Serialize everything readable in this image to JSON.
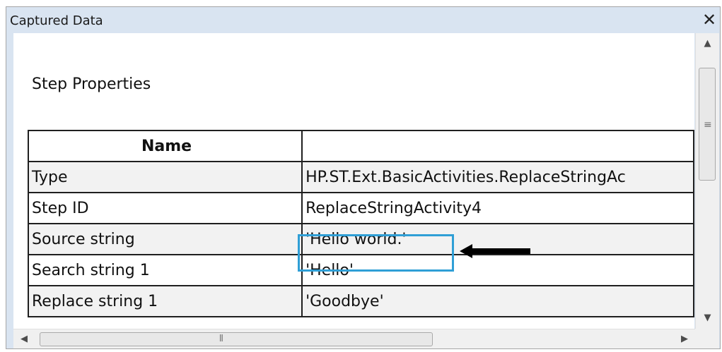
{
  "window": {
    "title": "Captured Data",
    "close_glyph": "✕"
  },
  "section": {
    "title": "Step Properties"
  },
  "table": {
    "columns": [
      "Name",
      ""
    ],
    "rows": [
      {
        "name": "Type",
        "value": "HP.ST.Ext.BasicActivities.ReplaceStringAc"
      },
      {
        "name": "Step ID",
        "value": "ReplaceStringActivity4"
      },
      {
        "name": "Source string",
        "value": "'Hello world.'"
      },
      {
        "name": "Search string 1",
        "value": "'Hello'"
      },
      {
        "name": "Replace string 1",
        "value": "'Goodbye'"
      }
    ]
  },
  "scrollbars": {
    "up_glyph": "▲",
    "down_glyph": "▼",
    "left_glyph": "◀",
    "right_glyph": "▶",
    "vgrip": "≡",
    "hgrip": "⦀"
  },
  "annotations": {
    "highlight_color": "#2f9fd6",
    "arrow_color": "#000000"
  }
}
